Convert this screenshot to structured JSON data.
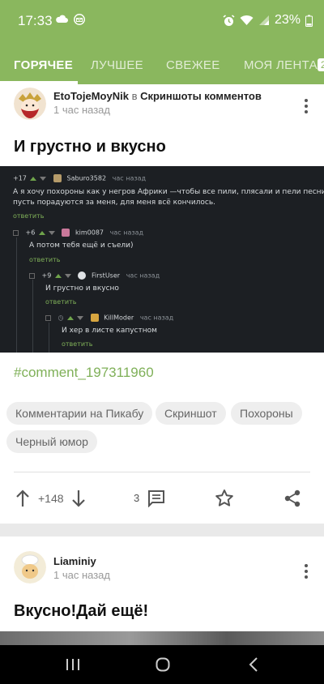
{
  "status_bar": {
    "time": "17:33",
    "battery": "23%"
  },
  "tabs": [
    {
      "label": "ГОРЯЧЕЕ",
      "active": true
    },
    {
      "label": "ЛУЧШЕЕ",
      "active": false
    },
    {
      "label": "СВЕЖЕЕ",
      "active": false
    },
    {
      "label": "МОЯ ЛЕНТА",
      "active": false
    }
  ],
  "tab_badge": "2",
  "post1": {
    "author": "EtoTojeMoyNik",
    "in_word": "в",
    "community": "Скриншоты комментов",
    "time": "1 час назад",
    "title": "И грустно и вкусно",
    "screenshot": {
      "comments": [
        {
          "score": "+17",
          "user": "Saburo3582",
          "time": "час назад",
          "text_lines": [
            "А я хочу похороны как у негров Африки —чтобы все пили, плясали и пели песни,",
            "пусть порадуются за меня, для меня всё кончилось."
          ],
          "reply": "ответить"
        },
        {
          "score": "+6",
          "user": "kim0087",
          "time": "час назад",
          "text_lines": [
            "А потом тебя ещё и съели)"
          ],
          "reply": "ответить"
        },
        {
          "score": "+9",
          "user": "FirstUser",
          "time": "час назад",
          "text_lines": [
            "И грустно и вкусно"
          ],
          "reply": "ответить"
        },
        {
          "score": "",
          "user": "KillModer",
          "time": "час назад",
          "text_lines": [
            "И хер в листе капустном"
          ],
          "reply": "ответить"
        }
      ]
    },
    "hashtag": "#comment_197311960",
    "tags": [
      "Комментарии на Пикабу",
      "Скриншот",
      "Похороны",
      "Черный юмор"
    ],
    "rating": "+148",
    "comments_count": "3"
  },
  "post2": {
    "author": "Liaminiy",
    "time": "1 час назад",
    "title": "Вкусно!Дай ещё!"
  },
  "colors": {
    "accent": "#8ab75e",
    "link": "#7fb058"
  },
  "icons": [
    "cloud-icon",
    "mail-icon",
    "alarm-icon",
    "wifi-icon",
    "signal-icon",
    "battery-icon",
    "kebab-menu-icon",
    "arrow-up-icon",
    "arrow-down-icon",
    "comment-icon",
    "star-icon",
    "share-icon",
    "recents-icon",
    "home-icon",
    "back-icon"
  ]
}
